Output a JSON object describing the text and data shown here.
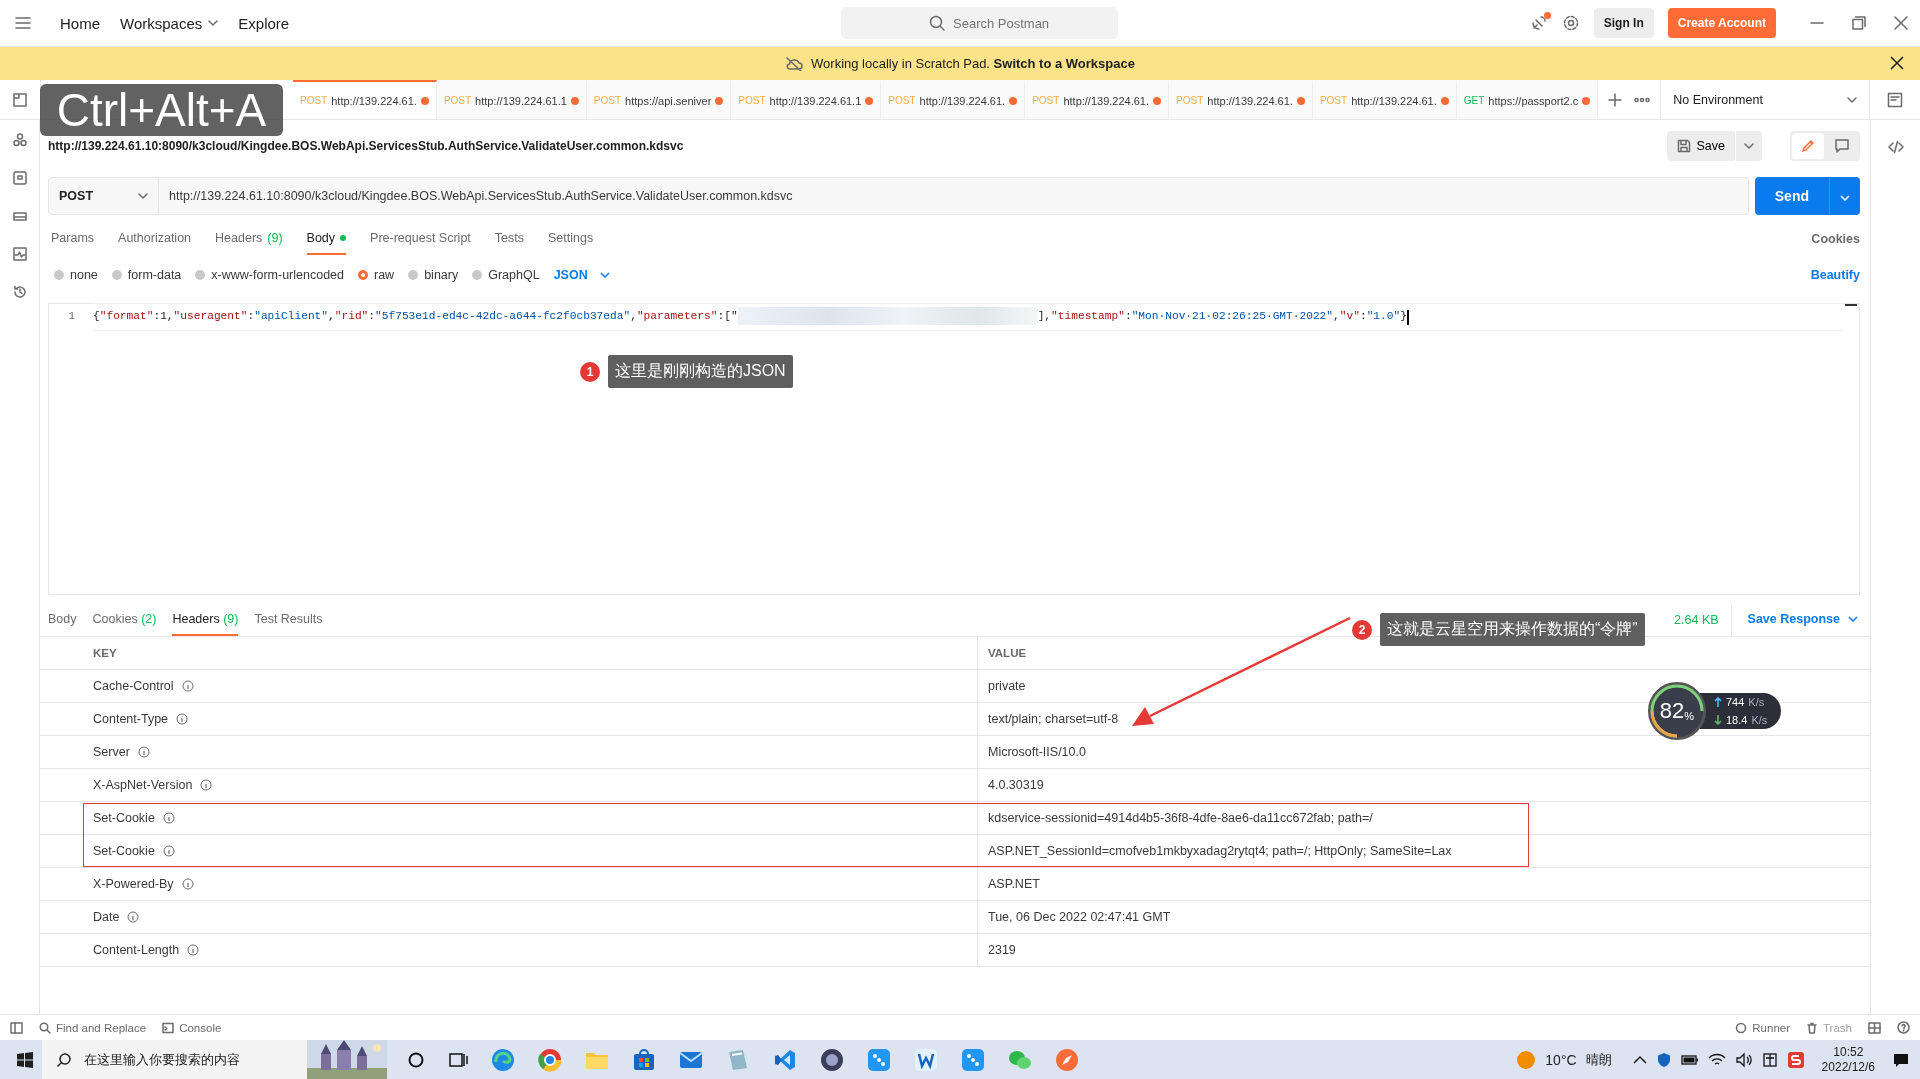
{
  "top_bar": {
    "nav": [
      {
        "label": "Home",
        "dropdown": false
      },
      {
        "label": "Workspaces",
        "dropdown": true
      },
      {
        "label": "Explore",
        "dropdown": false
      }
    ],
    "search": {
      "placeholder": "Search Postman"
    },
    "sign_in": "Sign In",
    "create_account": "Create Account",
    "notification_dot": true
  },
  "banner": {
    "text": "Working locally in Scratch Pad.",
    "link": "Switch to a Workspace"
  },
  "shortcut_overlay": "Ctrl+Alt+A",
  "tabs": [
    {
      "method": "POST",
      "url": "http://139.224.61.",
      "selected": true,
      "unsaved": true
    },
    {
      "method": "POST",
      "url": "http://139.224.61.1",
      "selected": false,
      "unsaved": true
    },
    {
      "method": "POST",
      "url": "https://api.seniver",
      "selected": false,
      "unsaved": true
    },
    {
      "method": "POST",
      "url": "http://139.224.61.1",
      "selected": false,
      "unsaved": true
    },
    {
      "method": "POST",
      "url": "http://139.224.61.",
      "selected": false,
      "unsaved": true
    },
    {
      "method": "POST",
      "url": "http://139.224.61.",
      "selected": false,
      "unsaved": true
    },
    {
      "method": "POST",
      "url": "http://139.224.61.",
      "selected": false,
      "unsaved": true
    },
    {
      "method": "POST",
      "url": "http://139.224.61.",
      "selected": false,
      "unsaved": true
    },
    {
      "method": "GET",
      "url": "https://passport2.c",
      "selected": false,
      "unsaved": true
    }
  ],
  "environment": "No Environment",
  "request": {
    "title": "http://139.224.61.10:8090/k3cloud/Kingdee.BOS.WebApi.ServicesStub.AuthService.ValidateUser.common.kdsvc",
    "save": "Save",
    "method": "POST",
    "url": "http://139.224.61.10:8090/k3cloud/Kingdee.BOS.WebApi.ServicesStub.AuthService.ValidateUser.common.kdsvc",
    "send": "Send",
    "tabs": [
      {
        "label": "Params",
        "selected": false
      },
      {
        "label": "Authorization",
        "selected": false
      },
      {
        "label": "Headers",
        "count": "(9)",
        "selected": false
      },
      {
        "label": "Body",
        "selected": true,
        "indicator": true
      },
      {
        "label": "Pre-request Script",
        "selected": false
      },
      {
        "label": "Tests",
        "selected": false
      },
      {
        "label": "Settings",
        "selected": false
      }
    ],
    "cookies_link": "Cookies",
    "body_types": [
      {
        "label": "none",
        "selected": false
      },
      {
        "label": "form-data",
        "selected": false
      },
      {
        "label": "x-www-form-urlencoded",
        "selected": false
      },
      {
        "label": "raw",
        "selected": true
      },
      {
        "label": "binary",
        "selected": false
      },
      {
        "label": "GraphQL",
        "selected": false
      }
    ],
    "format": "JSON",
    "beautify": "Beautify",
    "editor": {
      "line_number": "1",
      "text_before": "{\"format\":1,\"useragent\":\"apiClient\",\"rid\":\"5f753e1d-ed4c-42dc-a644-fc2f0cb37eda\",\"parameters\":[\"",
      "text_after": "],\"timestamp\":\"Mon·Nov·21·02:26:25·GMT·2022\",\"v\":\"1.0\"}"
    }
  },
  "response": {
    "tabs": [
      {
        "label": "Body",
        "selected": false
      },
      {
        "label": "Cookies",
        "count": "(2)",
        "selected": false
      },
      {
        "label": "Headers",
        "count": "(9)",
        "selected": true
      },
      {
        "label": "Test Results",
        "selected": false
      }
    ],
    "size": "2.64 KB",
    "save_response": "Save Response",
    "columns": [
      "KEY",
      "VALUE"
    ],
    "rows": [
      {
        "key": "Cache-Control",
        "value": "private",
        "highlighted": false
      },
      {
        "key": "Content-Type",
        "value": "text/plain; charset=utf-8",
        "highlighted": false
      },
      {
        "key": "Server",
        "value": "Microsoft-IIS/10.0",
        "highlighted": false
      },
      {
        "key": "X-AspNet-Version",
        "value": "4.0.30319",
        "highlighted": false
      },
      {
        "key": "Set-Cookie",
        "value": "kdservice-sessionid=4914d4b5-36f8-4dfe-8ae6-da11cc672fab; path=/",
        "highlighted": true
      },
      {
        "key": "Set-Cookie",
        "value": "ASP.NET_SessionId=cmofveb1mkbyxadag2rytqt4; path=/; HttpOnly; SameSite=Lax",
        "highlighted": true
      },
      {
        "key": "X-Powered-By",
        "value": "ASP.NET",
        "highlighted": false
      },
      {
        "key": "Date",
        "value": "Tue, 06 Dec 2022 02:47:41 GMT",
        "highlighted": false
      },
      {
        "key": "Content-Length",
        "value": "2319",
        "highlighted": false
      }
    ]
  },
  "annotations": [
    {
      "number": "1",
      "text": "这里是刚刚构造的JSON"
    },
    {
      "number": "2",
      "text": "这就是云星空用来操作数据的“令牌”"
    }
  ],
  "speed_widget": {
    "percent": "82",
    "percent_sign": "%",
    "upload": "744",
    "upload_unit": "K/s",
    "download": "18.4",
    "download_unit": "K/s"
  },
  "status_bar": {
    "left": [
      "Find and Replace",
      "Console"
    ],
    "right": [
      "Runner",
      "Trash"
    ]
  },
  "taskbar": {
    "search": {
      "placeholder": "在这里输入你要搜索的内容"
    },
    "temperature": "10°C",
    "weather": "晴朗",
    "time": "10:52",
    "date": "2022/12/6"
  }
}
